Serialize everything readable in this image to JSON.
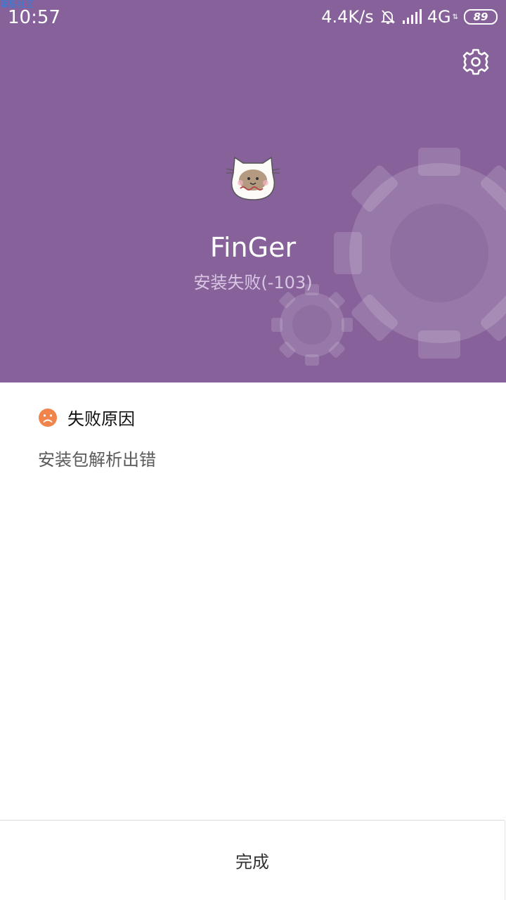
{
  "watermark": "添星社区",
  "status_bar": {
    "time": "10:57",
    "net_speed": "4.4K/s",
    "network": "4G",
    "battery": "89"
  },
  "app": {
    "name": "FinGer",
    "status": "安装失败(-103)"
  },
  "failure": {
    "title": "失败原因",
    "reason": "安装包解析出错"
  },
  "footer": {
    "done_label": "完成"
  },
  "colors": {
    "header_bg": "#86619a",
    "failure_icon": "#f0844a"
  },
  "icons": [
    "bell-muted-icon",
    "signal-icon",
    "data-arrows-icon",
    "battery-icon",
    "settings-gear-icon",
    "app-icon",
    "sad-face-icon"
  ]
}
